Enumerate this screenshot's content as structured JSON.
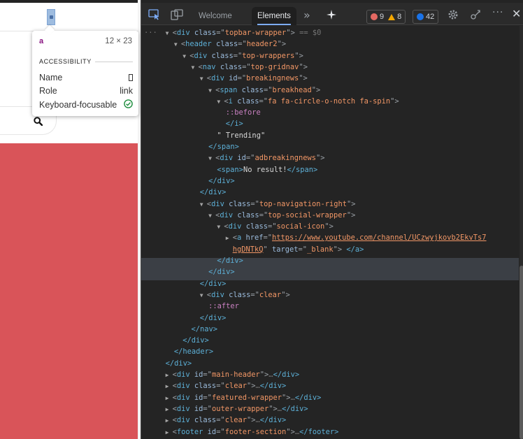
{
  "tooltip": {
    "tag": "a",
    "size": "12 × 23",
    "section": "ACCESSIBILITY",
    "rows": [
      {
        "label": "Name",
        "value": ""
      },
      {
        "label": "Role",
        "value": "link"
      },
      {
        "label": "Keyboard-focusable",
        "value": ""
      }
    ]
  },
  "devtools": {
    "tabs": [
      "Welcome",
      "Elements"
    ],
    "errors": "9",
    "warnings": "8",
    "info": "42",
    "colors": {
      "error": "#e46962",
      "warning": "#f2a600",
      "info": "#1a73e8",
      "accent": "#7cacf8"
    }
  },
  "tree": {
    "l0": {
      "ind": "···",
      "tag": "div",
      "attrs": [
        {
          "n": "class",
          "v": "topbar-wrapper"
        }
      ],
      "tail": "== $0"
    },
    "l1": {
      "tag": "header",
      "attrs": [
        {
          "n": "class",
          "v": "header2"
        }
      ]
    },
    "l2": {
      "tag": "div",
      "attrs": [
        {
          "n": "class",
          "v": "top-wrappers"
        }
      ]
    },
    "l3": {
      "tag": "nav",
      "attrs": [
        {
          "n": "class",
          "v": "top-gridnav"
        }
      ]
    },
    "l4": {
      "tag": "div",
      "attrs": [
        {
          "n": "id",
          "v": "breakingnews"
        }
      ]
    },
    "l5": {
      "tag": "span",
      "attrs": [
        {
          "n": "class",
          "v": "breakhead"
        }
      ]
    },
    "l6": {
      "tag": "i",
      "attrs": [
        {
          "n": "class",
          "v": "fa fa-circle-o-notch fa-spin"
        }
      ]
    },
    "l7": {
      "pseudo": "::before"
    },
    "l8": {
      "close": "</i>"
    },
    "l9": {
      "text": "\" Trending\""
    },
    "l10": {
      "close": "</span>"
    },
    "l11": {
      "tag": "div",
      "attrs": [
        {
          "n": "id",
          "v": "adbreakingnews"
        }
      ]
    },
    "l12": {
      "open": "<span>",
      "text": "No result!",
      "close": "</span>"
    },
    "l13": {
      "close": "</div>"
    },
    "l14": {
      "close": "</div>"
    },
    "l15": {
      "tag": "div",
      "attrs": [
        {
          "n": "class",
          "v": "top-navigation-right"
        }
      ]
    },
    "l16": {
      "tag": "div",
      "attrs": [
        {
          "n": "class",
          "v": "top-social-wrapper"
        }
      ]
    },
    "l17": {
      "tag": "div",
      "attrs": [
        {
          "n": "class",
          "v": "social-icon"
        }
      ]
    },
    "l18": {
      "tag": "a",
      "attr_name": "href",
      "url_part1": "https://www.youtube.com/channel/UCzwyjkovb2EkvTs7",
      "url_part2": "hgDNTkQ",
      "attr2_name": "target",
      "attr2_value": "_blank",
      "close": "</a>"
    },
    "l19": {
      "close": "</div>"
    },
    "l20": {
      "close": "</div>"
    },
    "l21": {
      "close": "</div>"
    },
    "l22": {
      "tag": "div",
      "attrs": [
        {
          "n": "class",
          "v": "clear"
        }
      ]
    },
    "l23": {
      "pseudo": "::after"
    },
    "l24": {
      "close": "</div>"
    },
    "l25": {
      "close": "</nav>"
    },
    "l26": {
      "close": "</div>"
    },
    "l27": {
      "close": "</header>"
    },
    "l28": {
      "close": "</div>"
    },
    "l29": {
      "tag": "div",
      "attrs": [
        {
          "n": "id",
          "v": "main-header"
        }
      ],
      "collapsed": true,
      "close": "</div>"
    },
    "l30": {
      "tag": "div",
      "attrs": [
        {
          "n": "class",
          "v": "clear"
        }
      ],
      "collapsed": true,
      "close": "</div>"
    },
    "l31": {
      "tag": "div",
      "attrs": [
        {
          "n": "id",
          "v": "featured-wrapper"
        }
      ],
      "collapsed": true,
      "close": "</div>"
    },
    "l32": {
      "tag": "div",
      "attrs": [
        {
          "n": "id",
          "v": "outer-wrapper"
        }
      ],
      "collapsed": true,
      "close": "</div>"
    },
    "l33": {
      "tag": "div",
      "attrs": [
        {
          "n": "class",
          "v": "clear"
        }
      ],
      "collapsed": true,
      "close": "</div>"
    },
    "l34": {
      "tag": "footer",
      "attrs": [
        {
          "n": "id",
          "v": "footer-section"
        }
      ],
      "collapsed": true,
      "close": "</footer>"
    }
  }
}
